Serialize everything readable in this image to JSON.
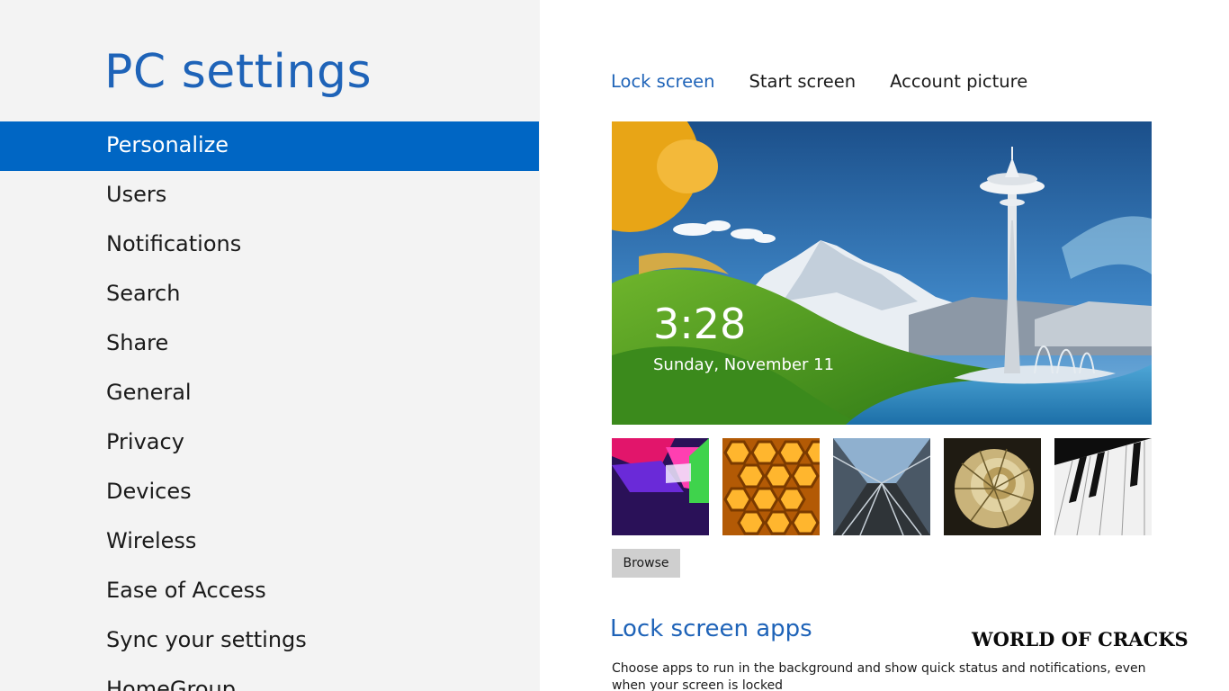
{
  "app": {
    "title": "PC settings"
  },
  "sidebar": {
    "items": [
      {
        "label": "Personalize",
        "selected": true
      },
      {
        "label": "Users"
      },
      {
        "label": "Notifications"
      },
      {
        "label": "Search"
      },
      {
        "label": "Share"
      },
      {
        "label": "General"
      },
      {
        "label": "Privacy"
      },
      {
        "label": "Devices"
      },
      {
        "label": "Wireless"
      },
      {
        "label": "Ease of Access"
      },
      {
        "label": "Sync your settings"
      },
      {
        "label": "HomeGroup"
      }
    ]
  },
  "tabs": [
    {
      "label": "Lock screen",
      "active": true
    },
    {
      "label": "Start screen"
    },
    {
      "label": "Account picture"
    }
  ],
  "preview": {
    "time": "3:28",
    "date": "Sunday, November 11"
  },
  "thumbnails": [
    "colorful-shapes-image",
    "honeycomb-image",
    "subway-tracks-image",
    "nautilus-shell-image",
    "piano-keys-image"
  ],
  "browse_label": "Browse",
  "lock_screen_apps": {
    "heading": "Lock screen apps",
    "description": "Choose apps to run in the background and show quick status and notifications, even when your screen is locked"
  },
  "watermark": "WORLD OF CRACKS",
  "colors": {
    "accent": "#0066c4",
    "accent_text": "#1e63b8",
    "sidebar_bg": "#f3f3f3",
    "button_bg": "#cfcfcf"
  }
}
